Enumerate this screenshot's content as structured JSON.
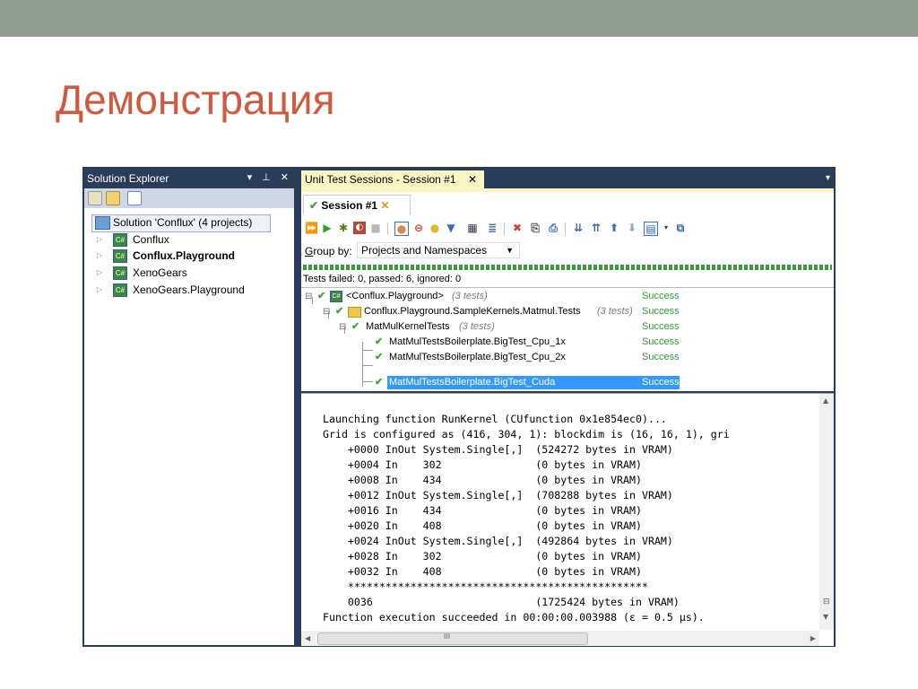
{
  "slide": {
    "title": "Демонстрация"
  },
  "solution_explorer": {
    "title": "Solution Explorer",
    "controls": "▾ ⊥ ✕",
    "solution": "Solution 'Conflux' (4 projects)",
    "projects": [
      {
        "label": "Conflux",
        "bold": false
      },
      {
        "label": "Conflux.Playground",
        "bold": true
      },
      {
        "label": "XenoGears",
        "bold": false
      },
      {
        "label": "XenoGears.Playground",
        "bold": false
      }
    ]
  },
  "unit_test": {
    "doc_tab": "Unit Test Sessions - Session #1",
    "session_tab": "Session #1",
    "group_by_prefix": "G",
    "group_by_rest": "roup by:",
    "group_by_value": "Projects and Namespaces",
    "summary": "Tests failed: 0, passed: 6, ignored: 0",
    "tree": [
      {
        "name": "<Conflux.Playground>",
        "count": "(3 tests)",
        "status": "Success"
      },
      {
        "name": "Conflux.Playground.SampleKernels.Matmul.Tests",
        "count": "(3 tests)",
        "status": "Success"
      },
      {
        "name": "MatMulKernelTests",
        "count": "(3 tests)",
        "status": "Success"
      },
      {
        "name": "MatMulTestsBoilerplate.BigTest_Cpu_1x",
        "count": "",
        "status": "Success"
      },
      {
        "name": "MatMulTestsBoilerplate.BigTest_Cpu_2x",
        "count": "",
        "status": "Success"
      },
      {
        "name": "MatMulTestsBoilerplate.BigTest_Cuda",
        "count": "",
        "status": "Success"
      }
    ]
  },
  "output": {
    "lines": [
      "Launching function RunKernel (CUfunction 0x1e854ec0)...",
      "Grid is configured as (416, 304, 1): blockdim is (16, 16, 1), gri",
      "    +0000 InOut System.Single[,]  (524272 bytes in VRAM)",
      "    +0004 In    302               (0 bytes in VRAM)",
      "    +0008 In    434               (0 bytes in VRAM)",
      "    +0012 InOut System.Single[,]  (708288 bytes in VRAM)",
      "    +0016 In    434               (0 bytes in VRAM)",
      "    +0020 In    408               (0 bytes in VRAM)",
      "    +0024 InOut System.Single[,]  (492864 bytes in VRAM)",
      "    +0028 In    302               (0 bytes in VRAM)",
      "    +0032 In    408               (0 bytes in VRAM)",
      "    ************************************************",
      "    0036                          (1725424 bytes in VRAM)",
      "Function execution succeeded in 00:00:00.003988 (ε = 0.5 µs)."
    ],
    "hscroll_thumb": "III"
  },
  "colors": {
    "title": "#d1593f",
    "topbar": "#8f9c91",
    "vs_frame": "#2b3c59",
    "success": "#2c9f2e",
    "selection": "#3399ff"
  }
}
